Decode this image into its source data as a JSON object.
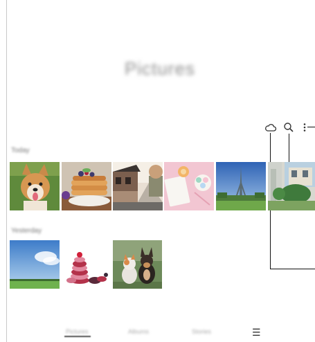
{
  "app": {
    "title": "Pictures"
  },
  "actions": [
    {
      "name": "cloud-icon",
      "glyph": ""
    },
    {
      "name": "search-icon",
      "glyph": ""
    },
    {
      "name": "more-options-icon",
      "glyph": "⋮"
    }
  ],
  "sections": [
    {
      "label": "Today"
    },
    {
      "label": "Yesterday"
    }
  ],
  "nav": {
    "items": [
      "Pictures",
      "Albums",
      "Stories"
    ],
    "menu_glyph": "☰"
  }
}
